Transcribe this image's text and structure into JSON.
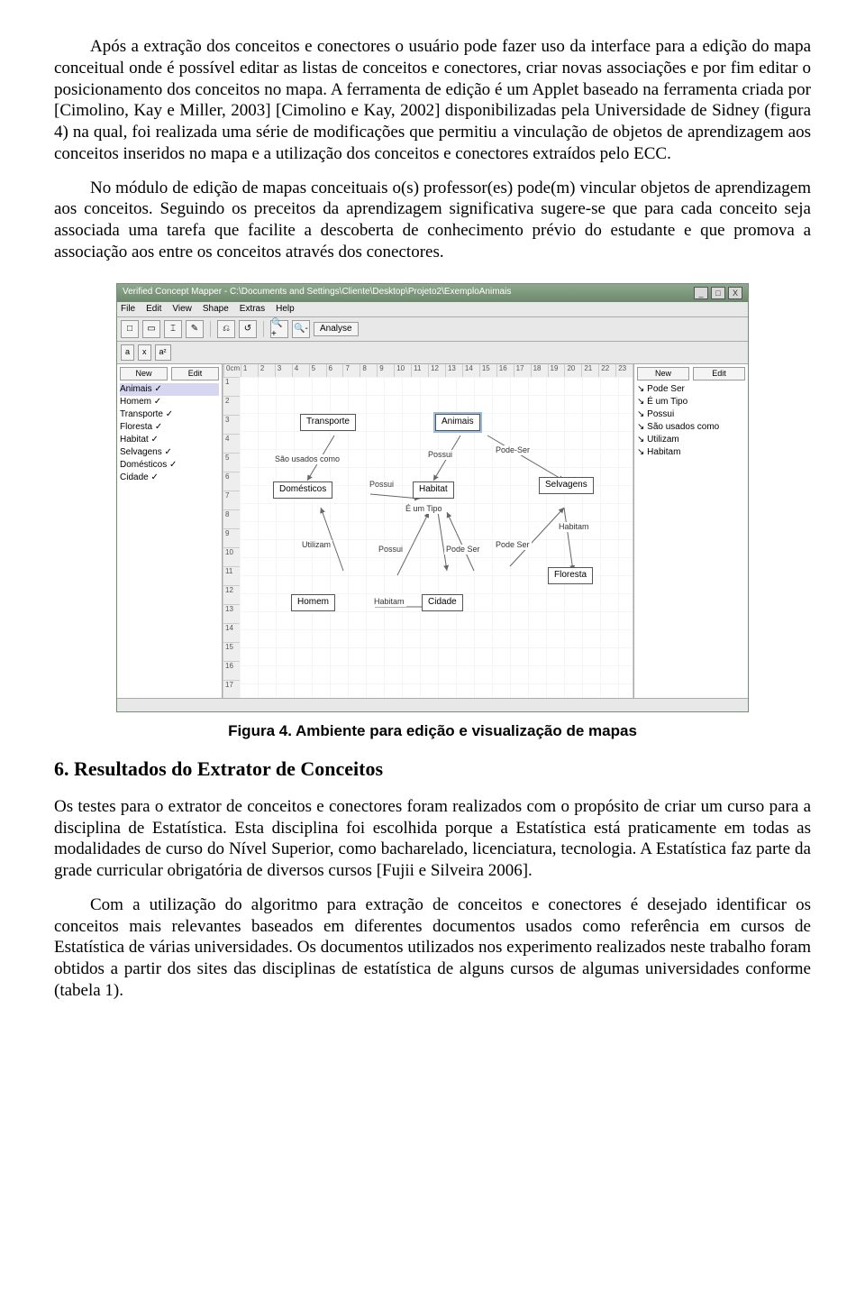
{
  "paragraphs": {
    "p1": "Após a extração dos conceitos e conectores o usuário pode fazer uso da interface para a edição do mapa conceitual onde é possível editar as listas de conceitos e conectores, criar novas associações e por fim editar o posicionamento dos conceitos no mapa. A ferramenta de edição é um Applet baseado na ferramenta criada por [Cimolino, Kay e Miller, 2003] [Cimolino e Kay, 2002] disponibilizadas pela Universidade de Sidney (figura 4) na qual, foi realizada uma série de modificações que permitiu a vinculação de objetos de aprendizagem aos conceitos inseridos no mapa e a utilização dos conceitos e conectores extraídos pelo ECC.",
    "p2": "No módulo de edição de mapas conceituais o(s) professor(es) pode(m) vincular objetos de aprendizagem aos conceitos. Seguindo os preceitos da aprendizagem significativa sugere-se que para cada conceito seja associada uma tarefa que facilite a descoberta de conhecimento prévio do estudante e que promova a associação aos entre os conceitos através dos conectores.",
    "p3": "Os testes para o extrator de conceitos e conectores foram realizados com o propósito de criar um curso para a disciplina de Estatística. Esta disciplina foi escolhida porque a Estatística está praticamente em todas as modalidades de curso do Nível Superior, como bacharelado, licenciatura, tecnologia. A Estatística faz parte da grade curricular obrigatória de diversos cursos [Fujii e Silveira 2006].",
    "p4": "Com a utilização do algoritmo para extração de conceitos e conectores é desejado identificar os conceitos mais relevantes baseados em diferentes documentos usados como referência em cursos de Estatística de várias universidades. Os documentos utilizados nos experimento realizados neste trabalho foram obtidos a partir dos sites das disciplinas de estatística de alguns cursos de algumas universidades conforme (tabela 1)."
  },
  "figure_caption": "Figura 4. Ambiente para edição e visualização de mapas",
  "section_heading": "6. Resultados do Extrator de Conceitos",
  "applet": {
    "title": "Verified Concept Mapper - C:\\Documents and Settings\\Cliente\\Desktop\\Projeto2\\ExemploAnimais",
    "menu": [
      "File",
      "Edit",
      "View",
      "Shape",
      "Extras",
      "Help"
    ],
    "toolbar": {
      "icons": [
        "□",
        "▭",
        "⌶",
        "✎",
        "⎌",
        "↺",
        "🔍+",
        "🔍-"
      ],
      "analyse": "Analyse"
    },
    "subbar": [
      "a",
      "x",
      "a²"
    ],
    "left_panel": {
      "buttons": [
        "New",
        "Edit"
      ],
      "items": [
        "Animais ✓",
        "Homem ✓",
        "Transporte ✓",
        "Floresta ✓",
        "Habitat ✓",
        "Selvagens ✓",
        "Domésticos ✓",
        "Cidade ✓"
      ]
    },
    "right_panel": {
      "buttons": [
        "New",
        "Edit"
      ],
      "items": [
        "↘ Pode Ser",
        "↘ É um Tipo",
        "↘ Possui",
        "↘ São usados como",
        "↘ Utilizam",
        "↘ Habitam"
      ]
    },
    "ruler_top": [
      "0cm",
      "1",
      "2",
      "3",
      "4",
      "5",
      "6",
      "7",
      "8",
      "9",
      "10",
      "11",
      "12",
      "13",
      "14",
      "15",
      "16",
      "17",
      "18",
      "19",
      "20",
      "21",
      "22",
      "23"
    ],
    "ruler_left": [
      "1",
      "2",
      "3",
      "4",
      "5",
      "6",
      "7",
      "8",
      "9",
      "10",
      "11",
      "12",
      "13",
      "14",
      "15",
      "16",
      "17"
    ],
    "nodes": {
      "transporte": "Transporte",
      "animais": "Animais",
      "domesticos": "Domésticos",
      "habitat": "Habitat",
      "selvagens": "Selvagens",
      "homem": "Homem",
      "cidade": "Cidade",
      "floresta": "Floresta"
    },
    "edge_labels": {
      "l1": "São usados como",
      "l2": "Possui",
      "l3": "Pode-Ser",
      "l4": "Possui",
      "l5": "É um Tipo",
      "l6": "Utilizam",
      "l7": "Possui",
      "l8": "Pode Ser",
      "l9": "Pode Ser",
      "l10": "Habitam",
      "l11": "Habitam"
    },
    "win_buttons": [
      "_",
      "□",
      "X"
    ]
  }
}
